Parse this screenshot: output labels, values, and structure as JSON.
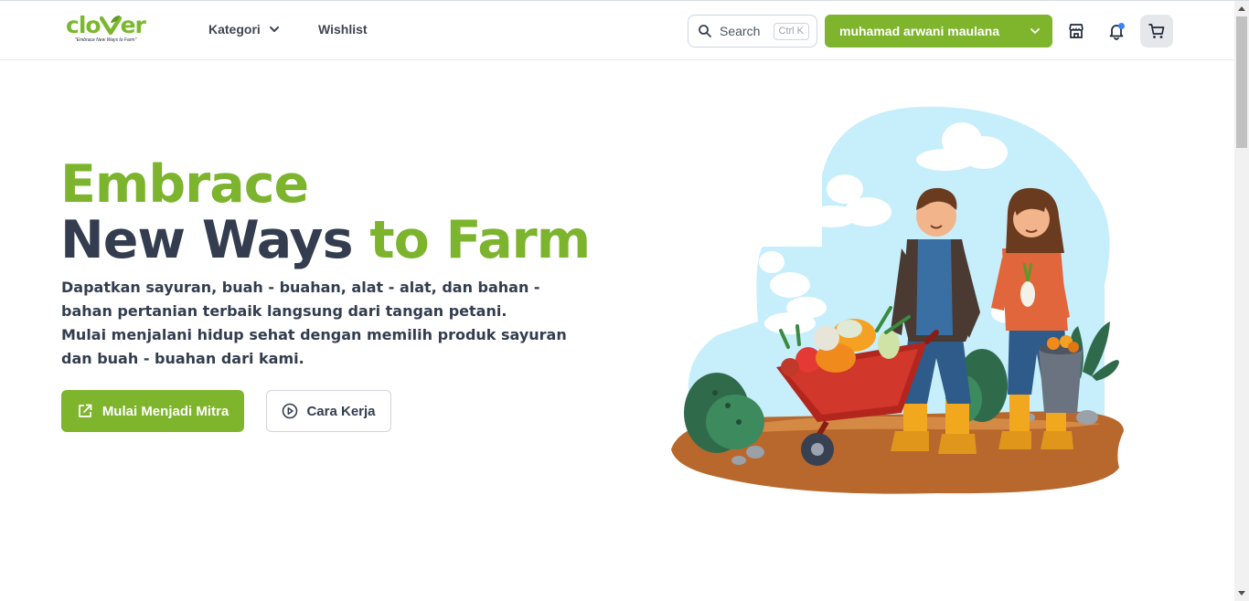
{
  "brand": {
    "logo_text": "clo",
    "logo_text_end": "er",
    "tagline": "\"Embrace New Ways to Farm\"",
    "accent": "#7fb42d",
    "dark": "#333d4f"
  },
  "nav": {
    "kategori": "Kategori",
    "wishlist": "Wishlist"
  },
  "search": {
    "label": "Search",
    "shortcut": "Ctrl K"
  },
  "user": {
    "name": "muhamad arwani maulana"
  },
  "icons": {
    "store": "store-icon",
    "notification": "bell-icon",
    "cart": "cart-icon"
  },
  "hero": {
    "line1": "Embrace",
    "line2a": "New Ways ",
    "line2b": "to Farm",
    "desc1": "Dapatkan sayuran, buah - buahan, alat - alat, dan bahan - bahan pertanian terbaik langsung dari tangan petani.",
    "desc2": "Mulai menjalani hidup sehat dengan memilih produk sayuran dan buah - buahan dari kami.",
    "cta_primary": "Mulai Menjadi Mitra",
    "cta_secondary": "Cara Kerja"
  }
}
